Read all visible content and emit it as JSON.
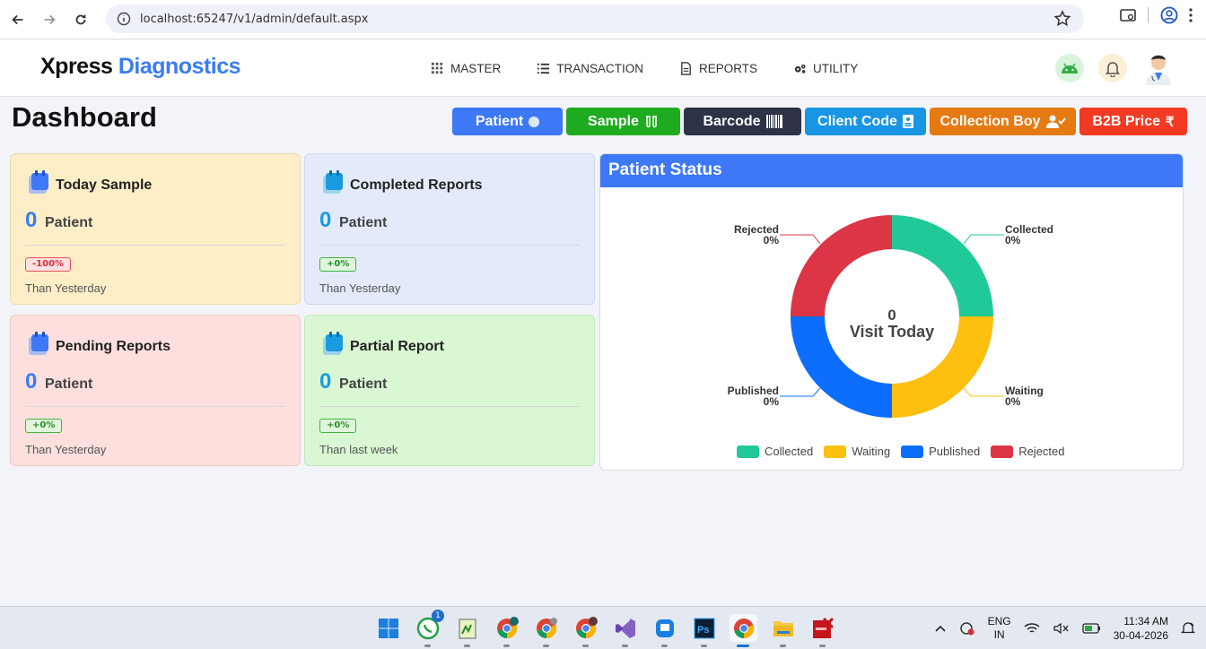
{
  "browser": {
    "url": "localhost:65247/v1/admin/default.aspx"
  },
  "header": {
    "logo_part1": "Xpress",
    "logo_part2": "Diagnostics",
    "nav": [
      {
        "label": "MASTER",
        "icon": "grid-icon"
      },
      {
        "label": "TRANSACTION",
        "icon": "list-icon"
      },
      {
        "label": "REPORTS",
        "icon": "file-icon"
      },
      {
        "label": "UTILITY",
        "icon": "gears-icon"
      }
    ]
  },
  "page": {
    "title": "Dashboard"
  },
  "quick_buttons": [
    {
      "label": "Patient",
      "glyph": "●",
      "color": "#3d78f6"
    },
    {
      "label": "Sample",
      "glyph": "⫴",
      "color": "#1fab1f"
    },
    {
      "label": "Barcode",
      "glyph": "|||||",
      "color": "#2c3347"
    },
    {
      "label": "Client Code",
      "glyph": "▮",
      "color": "#1895e3"
    },
    {
      "label": "Collection Boy",
      "glyph": "✔",
      "color": "#e57a12"
    },
    {
      "label": "B2B Price",
      "glyph": "₹",
      "color": "#f23a22"
    }
  ],
  "cards": [
    {
      "title": "Today Sample",
      "count": "0",
      "unit": "Patient",
      "badge": "-100%",
      "badge_type": "neg",
      "footer": "Than Yesterday",
      "bg": "#fdeec7"
    },
    {
      "title": "Completed Reports",
      "count": "0",
      "unit": "Patient",
      "badge": "+0%",
      "badge_type": "pos",
      "footer": "Than Yesterday",
      "bg": "#e3ebfb"
    },
    {
      "title": "Pending Reports",
      "count": "0",
      "unit": "Patient",
      "badge": "+0%",
      "badge_type": "pos",
      "footer": "Than Yesterday",
      "bg": "#fde0dd"
    },
    {
      "title": "Partial Report",
      "count": "0",
      "unit": "Patient",
      "badge": "+0%",
      "badge_type": "pos",
      "footer": "Than last week",
      "bg": "#d9f7d2"
    }
  ],
  "status": {
    "title": "Patient Status",
    "center_count": "0",
    "center_label": "Visit Today"
  },
  "chart_data": {
    "type": "pie",
    "title": "Patient Status",
    "categories": [
      "Collected",
      "Waiting",
      "Published",
      "Rejected"
    ],
    "values": [
      0,
      0,
      0,
      0
    ],
    "labels": [
      "0%",
      "0%",
      "0%",
      "0%"
    ],
    "colors": [
      "#20c997",
      "#fdc010",
      "#0d6efd",
      "#dc3545"
    ],
    "legend": "bottom"
  },
  "taskbar": {
    "lang1": "ENG",
    "lang2": "IN",
    "time": "11:34 AM",
    "date": "30-04-2026",
    "whatsapp_badge": "1"
  }
}
